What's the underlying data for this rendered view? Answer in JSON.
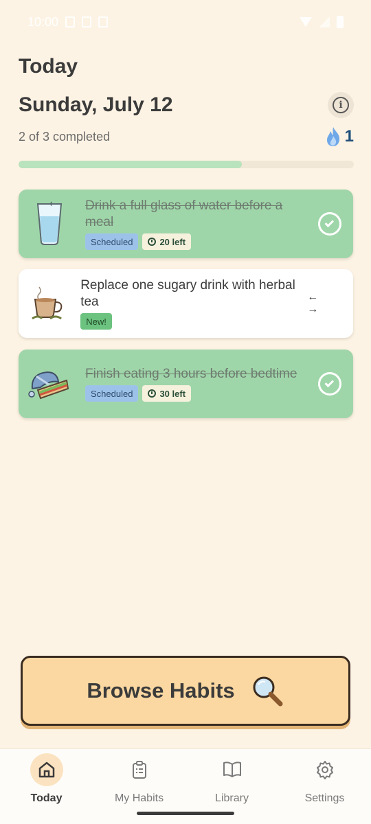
{
  "status_bar": {
    "time": "10:00"
  },
  "header": {
    "title": "Today",
    "date": "Sunday, July 12",
    "progress_text": "2 of 3 completed",
    "streak_count": "1",
    "progress_fraction": 0.667
  },
  "habits": [
    {
      "title": "Drink a full glass of water before a meal",
      "state": "completed",
      "tag_scheduled": "Scheduled",
      "tag_time": "20 left",
      "illustration": "water-glass-icon"
    },
    {
      "title": "Replace one sugary drink with herbal tea",
      "state": "pending",
      "tag_new": "New!",
      "swipe_hint": "← →",
      "illustration": "tea-cup-icon"
    },
    {
      "title": "Finish eating 3 hours before bedtime",
      "state": "completed",
      "tag_scheduled": "Scheduled",
      "tag_time": "30 left",
      "illustration": "sleeping-sandwich-icon"
    }
  ],
  "browse_button": {
    "label": "Browse Habits"
  },
  "nav": [
    {
      "label": "Today",
      "icon": "home-icon",
      "active": true
    },
    {
      "label": "My Habits",
      "icon": "clipboard-icon",
      "active": false
    },
    {
      "label": "Library",
      "icon": "book-icon",
      "active": false
    },
    {
      "label": "Settings",
      "icon": "gear-icon",
      "active": false
    }
  ],
  "colors": {
    "background": "#fdf3e4",
    "completed_card": "#9fd6a9",
    "progress_fill": "#b9e3bc",
    "browse_button": "#fbd8a1",
    "streak": "#1f4f7a"
  }
}
